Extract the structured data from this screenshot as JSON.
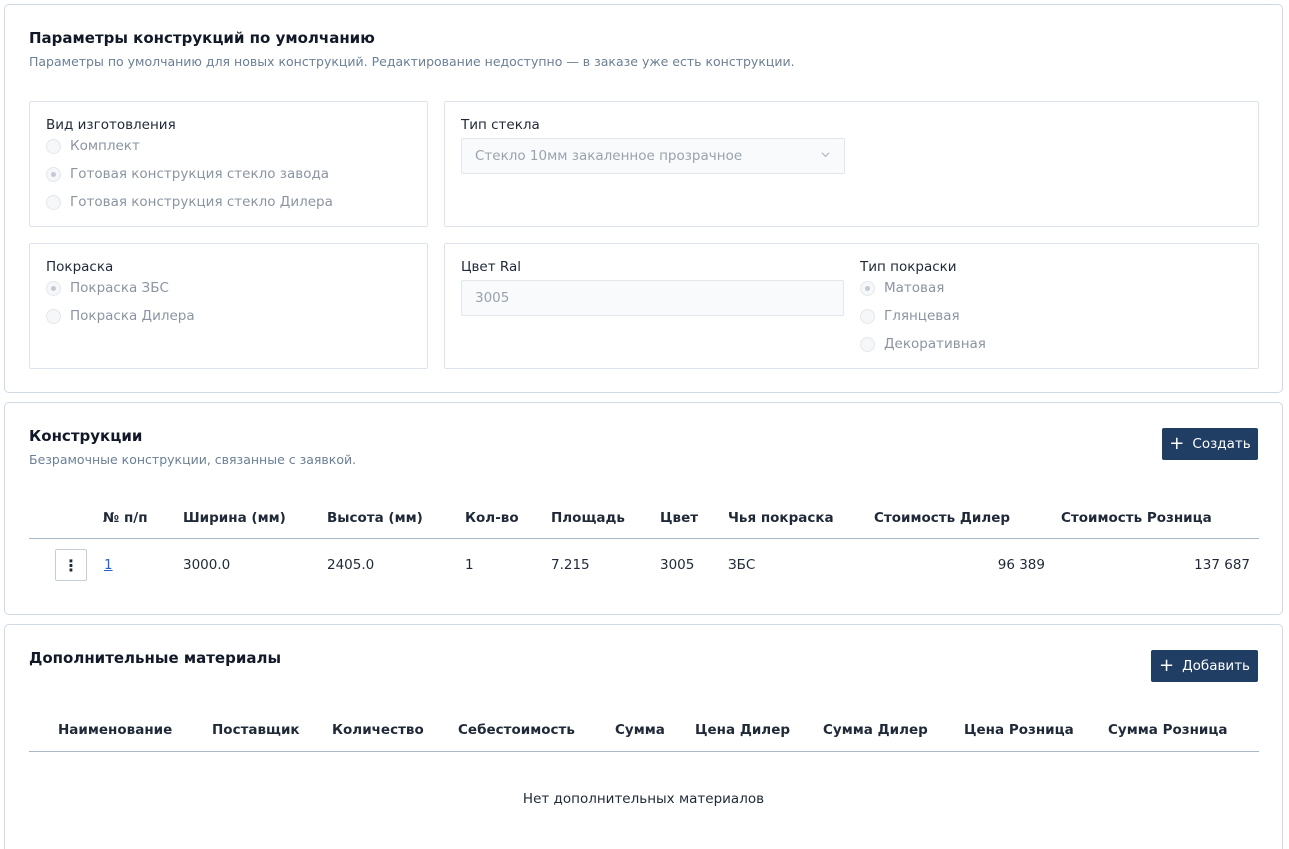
{
  "defaults": {
    "title": "Параметры конструкций по умолчанию",
    "subtitle": "Параметры по умолчанию для новых конструкций. Редактирование недоступно — в заказе уже есть конструкции.",
    "manufacture": {
      "label": "Вид изготовления",
      "options": [
        "Комплект",
        "Готовая конструкция стекло завода",
        "Готовая конструкция стекло Дилера"
      ],
      "selected_index": 1
    },
    "glass": {
      "label": "Тип стекла",
      "value": "Стекло 10мм закаленное прозрачное"
    },
    "paint": {
      "label": "Покраска",
      "options": [
        "Покраска ЗБС",
        "Покраска Дилера"
      ],
      "selected_index": 0
    },
    "ral": {
      "label": "Цвет Ral",
      "value": "3005"
    },
    "paint_type": {
      "label": "Тип покраски",
      "options": [
        "Матовая",
        "Глянцевая",
        "Декоративная"
      ],
      "selected_index": 0
    }
  },
  "constructions": {
    "title": "Конструкции",
    "subtitle": "Безрамочные конструкции, связанные с заявкой.",
    "create_label": "Создать",
    "columns": [
      "№ п/п",
      "Ширина (мм)",
      "Высота (мм)",
      "Кол-во",
      "Площадь",
      "Цвет",
      "Чья покраска",
      "Стоимость Дилер",
      "Стоимость Розница"
    ],
    "rows": [
      {
        "num": "1",
        "width": "3000.0",
        "height": "2405.0",
        "qty": "1",
        "area": "7.215",
        "color": "3005",
        "painter": "ЗБС",
        "cost_dealer": "96 389",
        "cost_retail": "137 687"
      }
    ]
  },
  "materials": {
    "title": "Дополнительные материалы",
    "add_label": "Добавить",
    "columns": [
      "Наименование",
      "Поставщик",
      "Количество",
      "Себестоимость",
      "Сумма",
      "Цена Дилер",
      "Сумма Дилер",
      "Цена Розница",
      "Сумма Розница"
    ],
    "empty_text": "Нет дополнительных материалов"
  }
}
